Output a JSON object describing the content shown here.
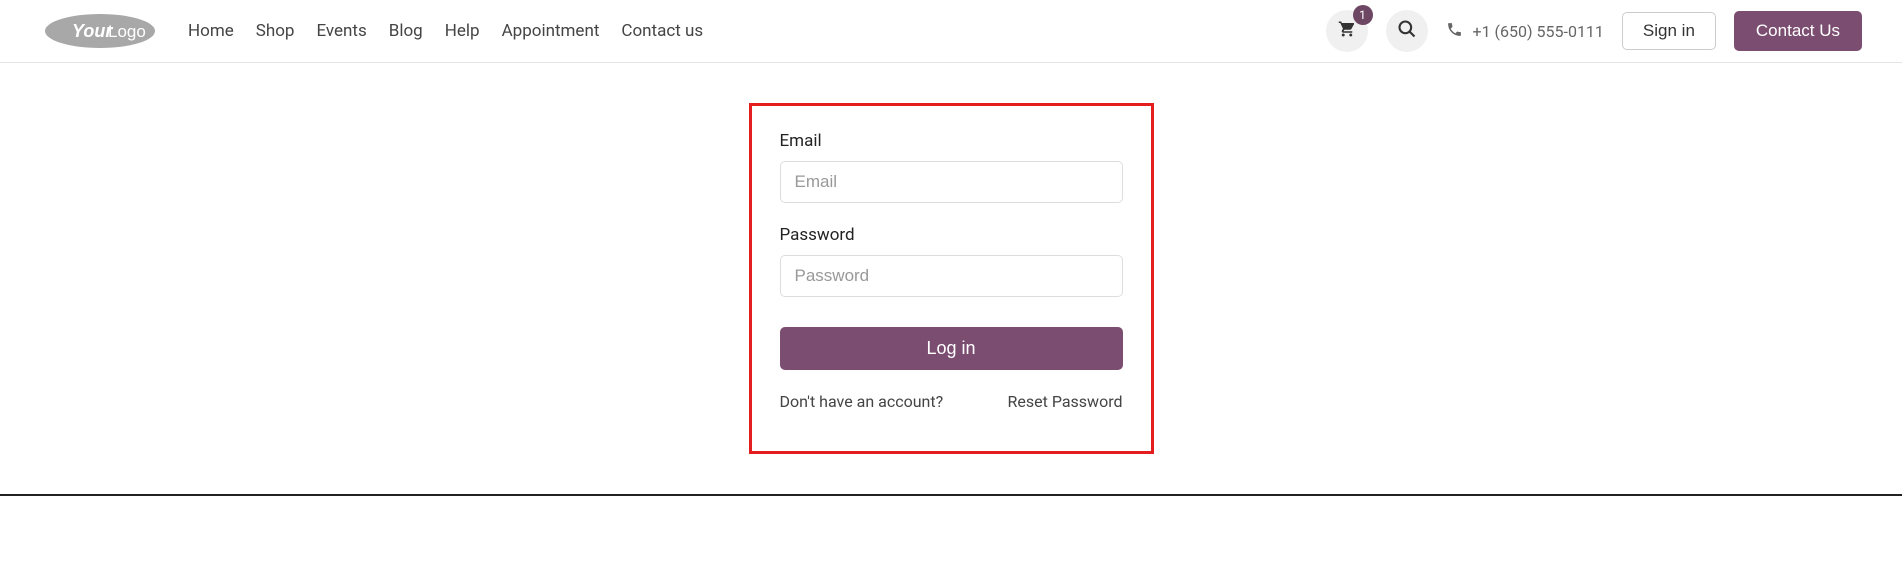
{
  "header": {
    "logo_text_1": "Your",
    "logo_text_2": "Logo",
    "nav": [
      "Home",
      "Shop",
      "Events",
      "Blog",
      "Help",
      "Appointment",
      "Contact us"
    ],
    "cart_badge": "1",
    "phone": "+1 (650) 555-0111",
    "signin": "Sign in",
    "contact_us": "Contact Us"
  },
  "login": {
    "email_label": "Email",
    "email_placeholder": "Email",
    "password_label": "Password",
    "password_placeholder": "Password",
    "login_btn": "Log in",
    "no_account": "Don't have an account?",
    "reset": "Reset Password"
  }
}
